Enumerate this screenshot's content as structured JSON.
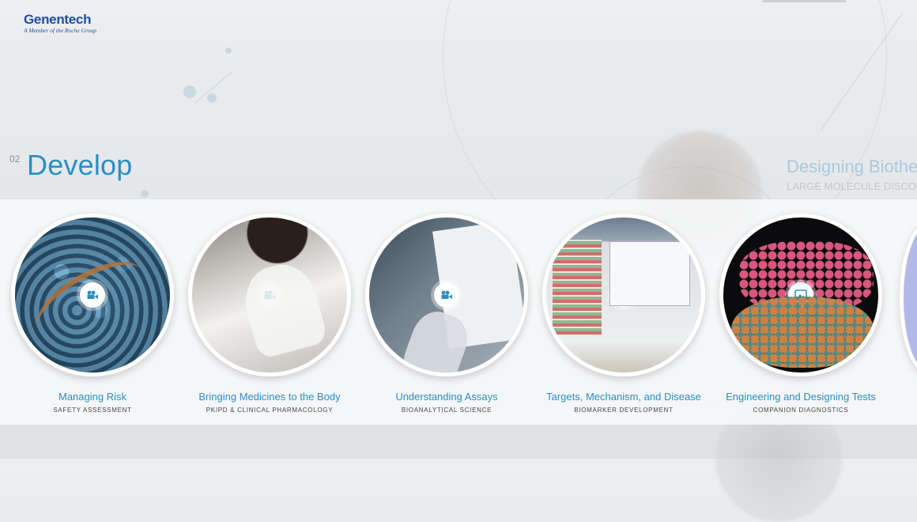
{
  "logo": {
    "name": "Genentech",
    "tagline": "A Member of the Roche Group"
  },
  "section": {
    "number": "02",
    "title": "Develop"
  },
  "colors": {
    "accent": "#2b8fc4",
    "logo": "#1f4ea1",
    "subtitle": "#444444"
  },
  "cards": [
    {
      "title": "Managing Risk",
      "subtitle": "SAFETY ASSESSMENT",
      "media_icon": "video-camera-icon"
    },
    {
      "title": "Bringing Medicines to the Body",
      "subtitle": "PK/PD & CLINICAL PHARMACOLOGY",
      "media_icon": "video-camera-icon"
    },
    {
      "title": "Understanding Assays",
      "subtitle": "BIOANALYTICAL SCIENCE",
      "media_icon": "video-camera-icon"
    },
    {
      "title": "Targets, Mechanism, and Disease",
      "subtitle": "BIOMARKER DEVELOPMENT",
      "media_icon": "video-camera-icon"
    },
    {
      "title": "Engineering and Designing Tests",
      "subtitle": "COMPANION DIAGNOSTICS",
      "media_icon": "image-gallery-icon"
    }
  ]
}
